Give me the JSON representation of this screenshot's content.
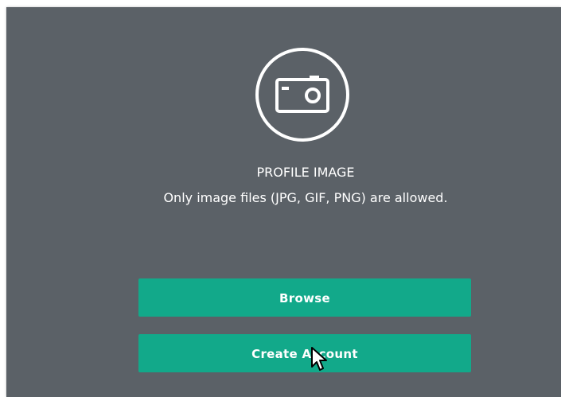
{
  "profile": {
    "icon": "camera-icon",
    "title": "PROFILE IMAGE",
    "hint": "Only image files (JPG, GIF, PNG) are allowed."
  },
  "actions": {
    "browse_label": "Browse",
    "create_account_label": "Create Account"
  },
  "colors": {
    "panel_background": "#5b6167",
    "button_background": "#12a98a",
    "text": "#ffffff"
  }
}
